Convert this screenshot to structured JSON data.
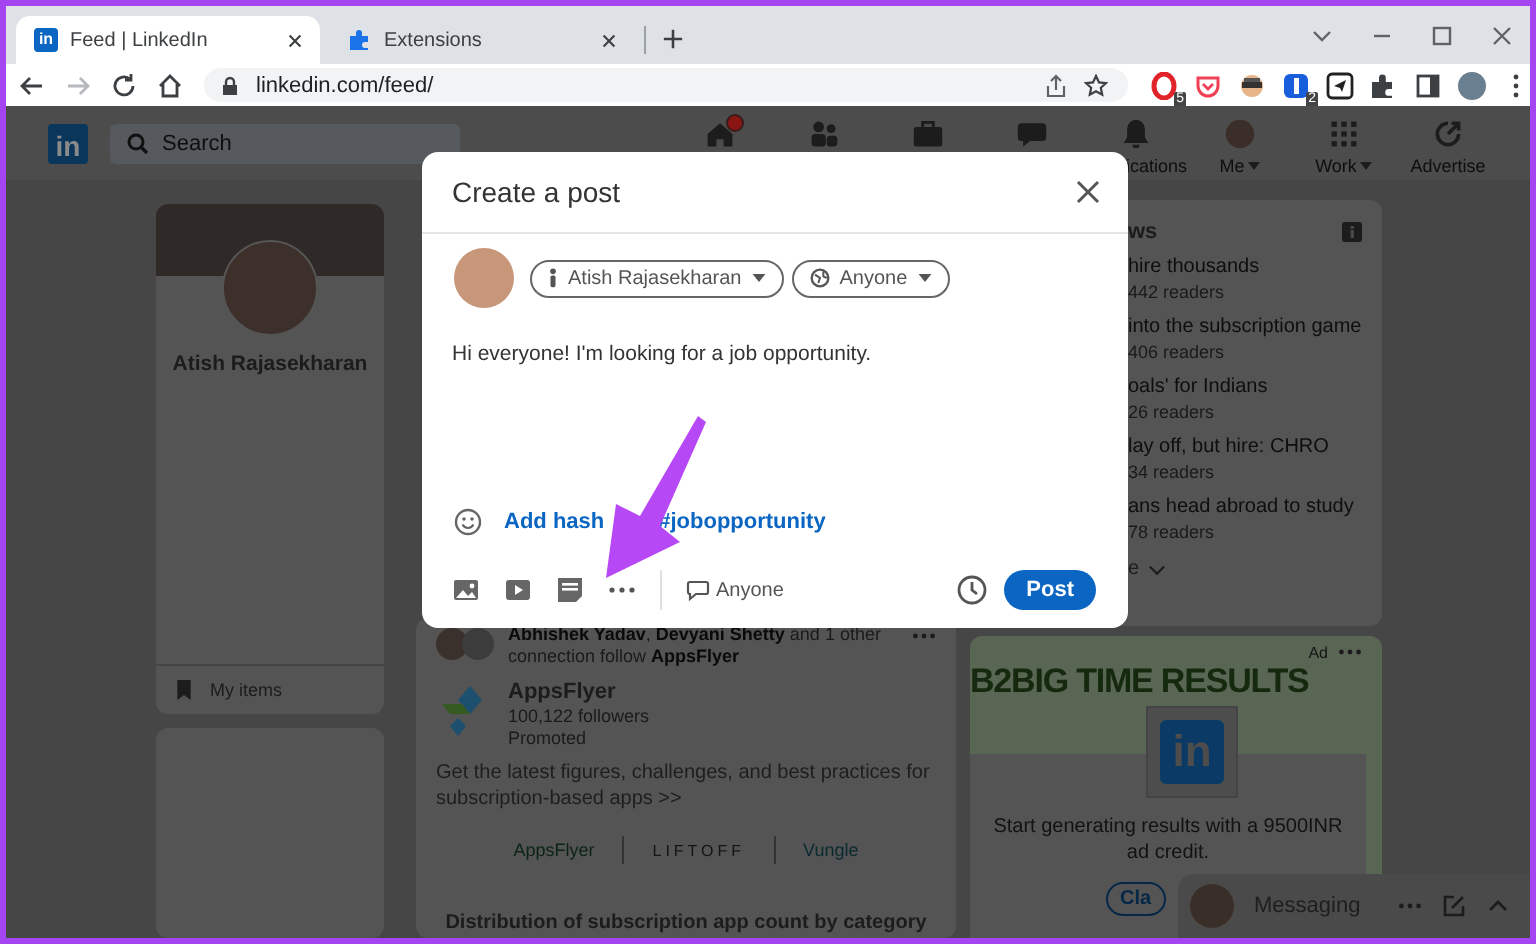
{
  "browser": {
    "tabs": [
      {
        "title": "Feed | LinkedIn",
        "favicon": "in",
        "selected": true
      },
      {
        "title": "Extensions",
        "selected": false
      }
    ],
    "url": "linkedin.com/feed/",
    "forward_disabled": true,
    "extensions": [
      {
        "kind": "opera",
        "badge": "5"
      },
      {
        "kind": "pocket"
      },
      {
        "kind": "incognito"
      },
      {
        "kind": "password",
        "badge": "2"
      },
      {
        "kind": "send"
      }
    ]
  },
  "nav": {
    "logo": "in",
    "search_placeholder": "Search",
    "items": [
      {
        "kind": "home",
        "badge": true
      },
      {
        "kind": "network",
        "badge": false
      },
      {
        "kind": "jobs",
        "badge": false
      },
      {
        "kind": "messaging",
        "badge": false
      },
      {
        "kind": "notifications",
        "badge": false,
        "label": "ications"
      },
      {
        "kind": "me",
        "badge": false,
        "label": "Me"
      },
      {
        "kind": "work",
        "badge": false,
        "label": "Work"
      },
      {
        "kind": "advertise",
        "badge": false,
        "label": "Advertise"
      }
    ]
  },
  "profile": {
    "name": "Atish Rajasekharan",
    "my_items": "My items"
  },
  "modal": {
    "title": "Create a post",
    "author": "Atish Rajasekharan",
    "audience": "Anyone",
    "text": "Hi everyone! I'm looking for a job opportunity.",
    "add_hashtag": "Add hash",
    "hashtag": "#jobopportunity",
    "comment_audience": "Anyone",
    "post_button": "Post"
  },
  "post": {
    "social_line": "**Abhishek Yadav**, **Devyani Shetty** and 1 other connection follow **AppsFlyer**",
    "company": "AppsFlyer",
    "followers": "100,122 followers",
    "promoted": "Promoted",
    "body": "Get the latest figures, challenges, and best practices for subscription-based apps >>",
    "logos": [
      "AppsFlyer",
      "LIFTOFF",
      "Vungle"
    ],
    "image_title": "Distribution of subscription app count by category"
  },
  "news": {
    "heading": "ws",
    "items": [
      {
        "title": "hire thousands",
        "readers": "442 readers"
      },
      {
        "title": "into the subscription game",
        "readers": "406 readers"
      },
      {
        "title": "oals' for Indians",
        "readers": "26 readers"
      },
      {
        "title": "lay off, but hire: CHRO",
        "readers": "34 readers"
      },
      {
        "title": "ans head abroad to study",
        "readers": "78 readers"
      }
    ],
    "more": "e"
  },
  "ad": {
    "label": "Ad",
    "headline": "B2BIG TIME RESULTS",
    "logo": "in",
    "text": "Start generating results with a 9500INR ad credit.",
    "button": "Cla"
  },
  "messaging": {
    "label": "Messaging"
  }
}
